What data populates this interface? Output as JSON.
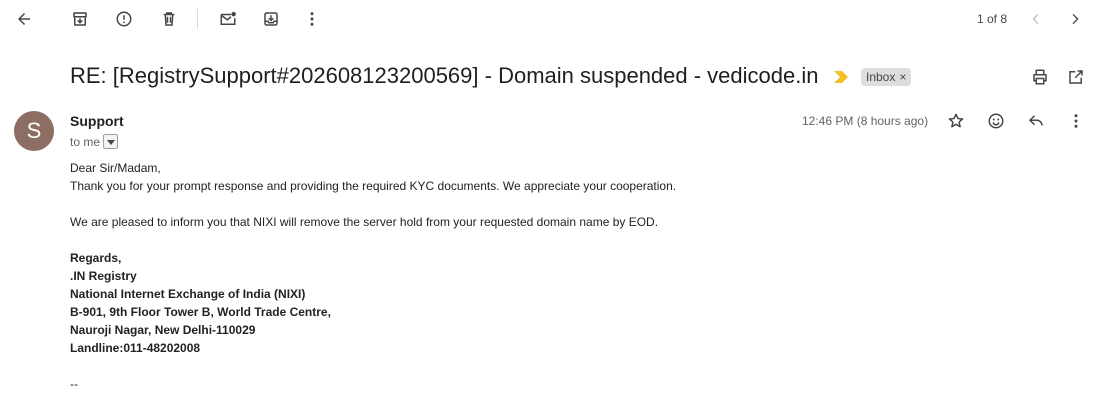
{
  "toolbar": {
    "back_icon": "arrow-left-icon",
    "archive_icon": "archive-icon",
    "report_spam_icon": "report-icon",
    "delete_icon": "trash-icon",
    "mark_unread_icon": "mark-unread-icon",
    "move_to_icon": "move-to-inbox-icon",
    "more_icon": "more-vert-icon"
  },
  "pagination": {
    "text": "1 of 8",
    "prev_icon": "chevron-left-icon",
    "next_icon": "chevron-right-icon"
  },
  "email": {
    "subject": "RE: [RegistrySupport#202608123200569] - Domain suspended - vedicode.in",
    "label": "Inbox",
    "label_remove": "×",
    "sender_initial": "S",
    "sender_name": "Support",
    "recipient": "to me",
    "timestamp": "12:46 PM (8 hours ago)",
    "body": {
      "greeting": "Dear Sir/Madam,",
      "line1": "Thank you for your prompt response and providing the required KYC documents. We appreciate your cooperation.",
      "line2": "We are pleased to inform you that NIXI will remove the server hold from your requested domain name by EOD."
    },
    "signature": {
      "regards": "Regards,",
      "org": ".IN Registry",
      "full_name": "National Internet Exchange of India (NIXI)",
      "address1": "B-901, 9th Floor Tower B, World Trade Centre,",
      "address2": "Nauroji Nagar, New Delhi-110029",
      "phone": "Landline:011-48202008",
      "delimiter": "--"
    }
  },
  "colors": {
    "avatar_bg": "#8d6e63",
    "importance_marker": "#f6bf26",
    "label_bg": "#dddddd"
  }
}
